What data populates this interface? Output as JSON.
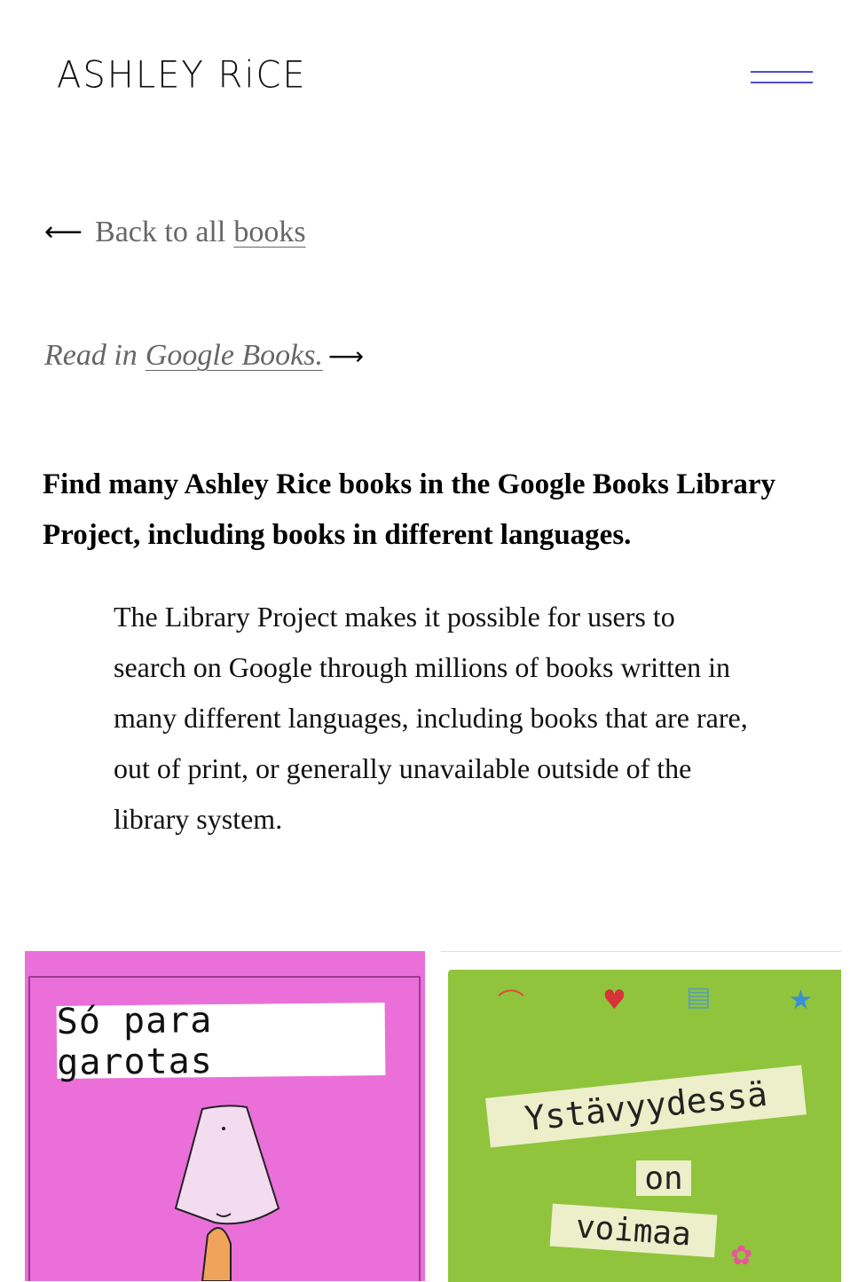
{
  "header": {
    "logo_text": "ASHLEY RiCE",
    "menu_icon": "hamburger-menu-icon",
    "accent_color": "#4c4cd6"
  },
  "back_link": {
    "prefix": "Back to all",
    "link_text": "books",
    "icon": "arrow-left-icon"
  },
  "read_line": {
    "prefix": "Read in",
    "link_text": "Google Books.",
    "icon": "arrow-right-icon"
  },
  "headline": "Find many Ashley Rice books in the Google Books Library Project, including books in different languages.",
  "quote": "The Library Project makes it possible for users to search on Google through millions of books written in many different languages, including books that are rare, out of print, or generally unavailable outside of the library system.",
  "books": [
    {
      "title": "Só para garotas",
      "cover_color": "#ea6fd9"
    },
    {
      "title_line1": "Ystävyydessä",
      "title_line2": "on",
      "title_line3": "voimaa",
      "cover_color": "#8fc43c"
    }
  ]
}
